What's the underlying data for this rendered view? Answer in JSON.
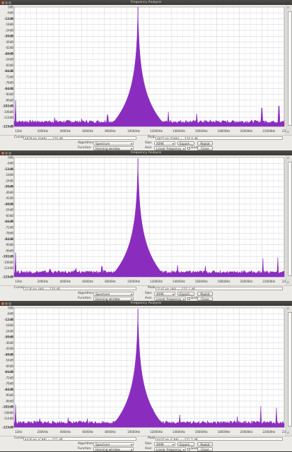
{
  "window_title": "Frequency Analysis",
  "colors": {
    "accent": "#e4683b",
    "spectrum": "#8a2dbe",
    "grid": "#cfcfcf"
  },
  "icons": {
    "magnify": "magnifier-icon",
    "zoom": "zoom-icon"
  },
  "y_ticks": [
    "0dB",
    "-6dB",
    "-12dB",
    "-18dB",
    "-24dB",
    "-30dB",
    "-36dB",
    "-42dB",
    "-48dB",
    "-54dB",
    "-60dB",
    "-66dB",
    "-72dB",
    "-78dB",
    "-84dB",
    "-90dB",
    "-96dB",
    "-102dB",
    "-108dB",
    "-114dB",
    "-123dB"
  ],
  "x_ticks": [
    "12Hz",
    "2000Hz",
    "4000Hz",
    "6000Hz",
    "8000Hz",
    "10000Hz",
    "12000Hz",
    "14000Hz",
    "16000Hz",
    "18000Hz",
    "20000Hz",
    "22000Hz",
    "23981Hz"
  ],
  "labels": {
    "cursor": "Cursor:",
    "peak": "Peak:",
    "algorithm": "Algorithm:",
    "size": "Size:",
    "function": "Function:",
    "axis": "Axis:",
    "export": "Export...",
    "replot": "Replot",
    "grids": "Grids",
    "close": "Close"
  },
  "windows": [
    {
      "cursor_value": "4879 Hz (D#8) = -120 dB",
      "peak_value": "4872 Hz (D#8) = -120.0 dB",
      "algorithm": "Spectrum",
      "size": "4096",
      "function": "Hanning window",
      "axis": "Linear frequency",
      "chart_data": {
        "type": "area",
        "xlabel": "",
        "ylabel": "",
        "xlim": [
          12,
          23981
        ],
        "ylim": [
          -123,
          0
        ],
        "peak": {
          "x": 11000,
          "y": 0
        },
        "noise_floor": -119,
        "spurs": [
          {
            "x": 150,
            "y": -96
          },
          {
            "x": 3600,
            "y": -114
          },
          {
            "x": 6000,
            "y": -115
          },
          {
            "x": 8300,
            "y": -111
          },
          {
            "x": 10000,
            "y": -104
          },
          {
            "x": 12100,
            "y": -103
          },
          {
            "x": 13700,
            "y": -108
          },
          {
            "x": 16200,
            "y": -110
          },
          {
            "x": 22000,
            "y": -104
          },
          {
            "x": 23500,
            "y": -102
          }
        ]
      }
    },
    {
      "cursor_value": "7130 Hz (A8) = -120 dB",
      "peak_value": "7147 Hz (A8) = -121.1 dB",
      "algorithm": "Spectrum",
      "size": "4096",
      "function": "Hanning window",
      "axis": "Linear frequency",
      "chart_data": {
        "type": "area",
        "xlabel": "",
        "ylabel": "",
        "xlim": [
          12,
          23981
        ],
        "ylim": [
          -123,
          0
        ],
        "peak": {
          "x": 11000,
          "y": -1
        },
        "noise_floor": -119,
        "spurs": [
          {
            "x": 150,
            "y": -98
          },
          {
            "x": 3200,
            "y": -115
          },
          {
            "x": 5500,
            "y": -114
          },
          {
            "x": 7800,
            "y": -112
          },
          {
            "x": 9900,
            "y": -105
          },
          {
            "x": 12200,
            "y": -104
          },
          {
            "x": 14500,
            "y": -111
          },
          {
            "x": 17000,
            "y": -112
          },
          {
            "x": 22100,
            "y": -104
          },
          {
            "x": 23400,
            "y": -103
          }
        ]
      }
    },
    {
      "cursor_value": "4430 Hz (C#8) = -121 dB",
      "peak_value": "4437 Hz (C#8) = -121.7 dB",
      "algorithm": "Spectrum",
      "size": "4096",
      "function": "Hanning window",
      "axis": "Linear frequency",
      "chart_data": {
        "type": "area",
        "xlabel": "",
        "ylabel": "",
        "xlim": [
          12,
          23981
        ],
        "ylim": [
          -123,
          0
        ],
        "peak": {
          "x": 11000,
          "y": -1
        },
        "noise_floor": -119,
        "spurs": [
          {
            "x": 150,
            "y": -100
          },
          {
            "x": 2300,
            "y": -114
          },
          {
            "x": 4800,
            "y": -113
          },
          {
            "x": 6500,
            "y": -114
          },
          {
            "x": 9800,
            "y": -106
          },
          {
            "x": 12300,
            "y": -104
          },
          {
            "x": 14700,
            "y": -110
          },
          {
            "x": 19800,
            "y": -112
          },
          {
            "x": 21900,
            "y": -101
          },
          {
            "x": 23300,
            "y": -103
          }
        ]
      }
    }
  ]
}
